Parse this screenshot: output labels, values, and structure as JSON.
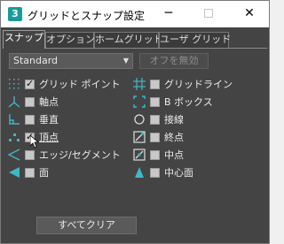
{
  "window": {
    "icon_label": "3",
    "title": "グリッドとスナップ設定",
    "minimize": "─",
    "close": "✕"
  },
  "tabs": [
    {
      "label": "スナップ",
      "active": true
    },
    {
      "label": "オプション",
      "active": false
    },
    {
      "label": "ホームグリッド",
      "active": false
    },
    {
      "label": "ユーザ グリッド",
      "active": false
    }
  ],
  "toolbar": {
    "dropdown_value": "Standard",
    "dropdown_chevron": "▼",
    "off_button": "オフを無効"
  },
  "snaps_left": [
    {
      "label": "グリッド ポイント",
      "checked": true,
      "icon": "grid-points-icon"
    },
    {
      "label": "軸点",
      "checked": false,
      "icon": "pivot-icon"
    },
    {
      "label": "垂直",
      "checked": false,
      "icon": "perpendicular-icon"
    },
    {
      "label": "頂点",
      "checked": true,
      "icon": "vertex-icon"
    },
    {
      "label": "エッジ/セグメント",
      "checked": false,
      "icon": "edge-segment-icon"
    },
    {
      "label": "面",
      "checked": false,
      "icon": "face-icon"
    }
  ],
  "snaps_right": [
    {
      "label": "グリッドライン",
      "checked": false,
      "icon": "grid-lines-icon"
    },
    {
      "label": "B ボックス",
      "checked": false,
      "icon": "bounding-box-icon"
    },
    {
      "label": "接線",
      "checked": false,
      "icon": "tangent-icon"
    },
    {
      "label": "終点",
      "checked": false,
      "icon": "endpoint-icon"
    },
    {
      "label": "中点",
      "checked": false,
      "icon": "midpoint-icon"
    },
    {
      "label": "中心面",
      "checked": false,
      "icon": "center-face-icon"
    }
  ],
  "footer": {
    "clear_all": "すべてクリア"
  },
  "colors": {
    "window_bg": "#444444",
    "icon_accent": "#3fb8c8",
    "text": "#ececec"
  }
}
